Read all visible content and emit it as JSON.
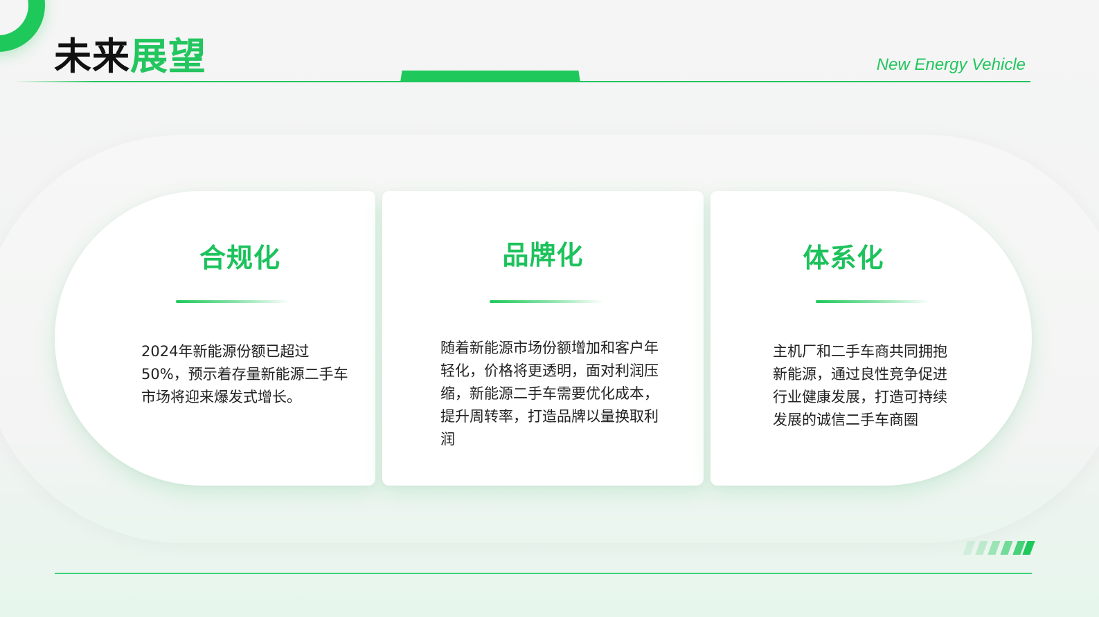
{
  "header": {
    "title_part1": "未来",
    "title_part2": "展望",
    "subtitle": "New Energy Vehicle"
  },
  "cards": [
    {
      "title": "合规化",
      "text": "2024年新能源份额已超过50%，预示着存量新能源二手车市场将迎来爆发式增长。"
    },
    {
      "title": "品牌化",
      "text": "随着新能源市场份额增加和客户年轻化，价格将更透明，面对利润压缩，新能源二手车需要优化成本，提升周转率，打造品牌以量换取利润"
    },
    {
      "title": "体系化",
      "text": "主机厂和二手车商共同拥抱新能源，通过良性竞争促进行业健康发展，打造可持续发展的诚信二手车商圈"
    }
  ],
  "colors": {
    "accent": "#22c55e",
    "title_dark": "#111111",
    "text": "#222222"
  }
}
